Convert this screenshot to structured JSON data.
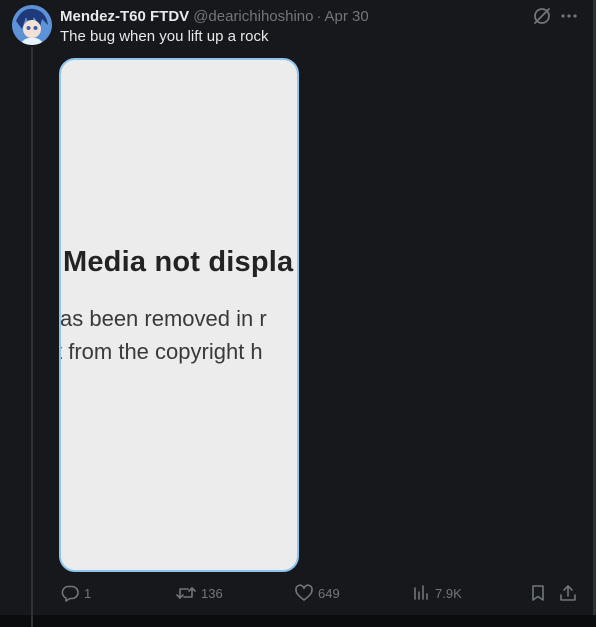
{
  "tweet": {
    "display_name": "Mendez-T60 FTDV",
    "handle": "@dearichihoshino",
    "separator": "·",
    "date": "Apr 30",
    "text": "The bug when you lift up a rock"
  },
  "media": {
    "title": "Media not displa",
    "line1": "as been removed in r",
    "line2": "t from the copyright h"
  },
  "actions": {
    "reply_count": "1",
    "retweet_count": "136",
    "like_count": "649",
    "views_count": "7.9K"
  },
  "icons": {
    "grok": "grok-icon",
    "more": "more-icon",
    "reply": "reply-icon",
    "retweet": "retweet-icon",
    "like": "heart-icon",
    "views": "views-icon",
    "bookmark": "bookmark-icon",
    "share": "share-icon"
  },
  "colors": {
    "background": "#16181c",
    "text_primary": "#e7e9ea",
    "text_secondary": "#71767b",
    "media_border": "#8ec5ee",
    "media_background": "#ececec"
  }
}
